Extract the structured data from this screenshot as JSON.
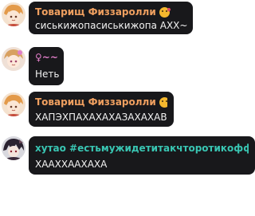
{
  "colors": {
    "bubble": "#18181b",
    "name_orange": "#f0a060",
    "name_pink": "#e07ec8",
    "name_teal": "#39c6b3",
    "text": "#f2f2f2"
  },
  "messages": [
    {
      "author": "Товарищ Физзаролли",
      "author_emoji": "smiling-face-with-heart-icon",
      "text": "сиськижопасиськижопа АХХ~"
    },
    {
      "author": "♀~~♀",
      "author_emoji": "",
      "text": "Неть"
    },
    {
      "author": "Товарищ Физзаролли",
      "author_emoji": "smiling-face-with-heart-icon",
      "text": "ХАПЭХПАХАХАХАЗАХАХАВ"
    },
    {
      "author": "хутао #естьмужидетитакчторотикофф#...",
      "author_emoji": "",
      "text": "ХААХХААХАХА"
    }
  ]
}
